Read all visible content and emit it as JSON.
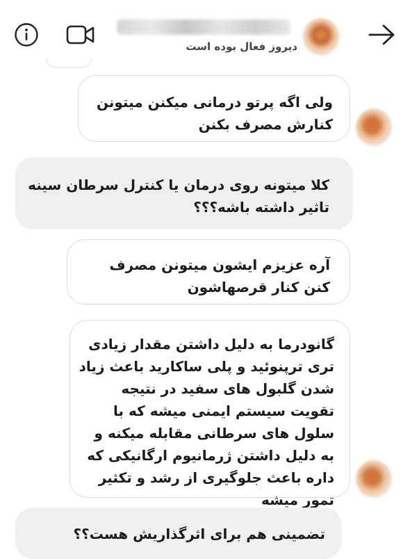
{
  "header": {
    "subtitle": "دیروز فعال بوده است",
    "icons": {
      "info": "info-icon",
      "video": "video-call-icon",
      "back": "arrow-right-icon"
    }
  },
  "messages": [
    {
      "direction": "outgoing",
      "text": "ولی اگه پرتو درمانی میکنن میتونن کنارش مصرف بکنن"
    },
    {
      "direction": "incoming",
      "text": "کلا میتونه روی درمان یا کنترل سرطان سینه تاثیر داشته باشه؟؟؟"
    },
    {
      "direction": "outgoing",
      "text": "آره عزیزم ایشون میتونن مصرف کنن کنار قرصهاشون"
    },
    {
      "direction": "outgoing",
      "text": "گانودرما به دلیل داشتن مقدار زیادی تری ترپنوئید و پلی ساکارید باعث زیاد شدن گلبول های سفید در نتیجه تقویت سیستم ایمنی میشه که با سلول های سرطانی مقابله میکنه و به دلیل داشتن ژرمانیوم ارگانیکی که داره باعث جلوگیری از رشد و تکثیر تمور میشه"
    },
    {
      "direction": "incoming",
      "text": "تضمینی هم برای اثرگذاریش هست؟؟"
    }
  ]
}
